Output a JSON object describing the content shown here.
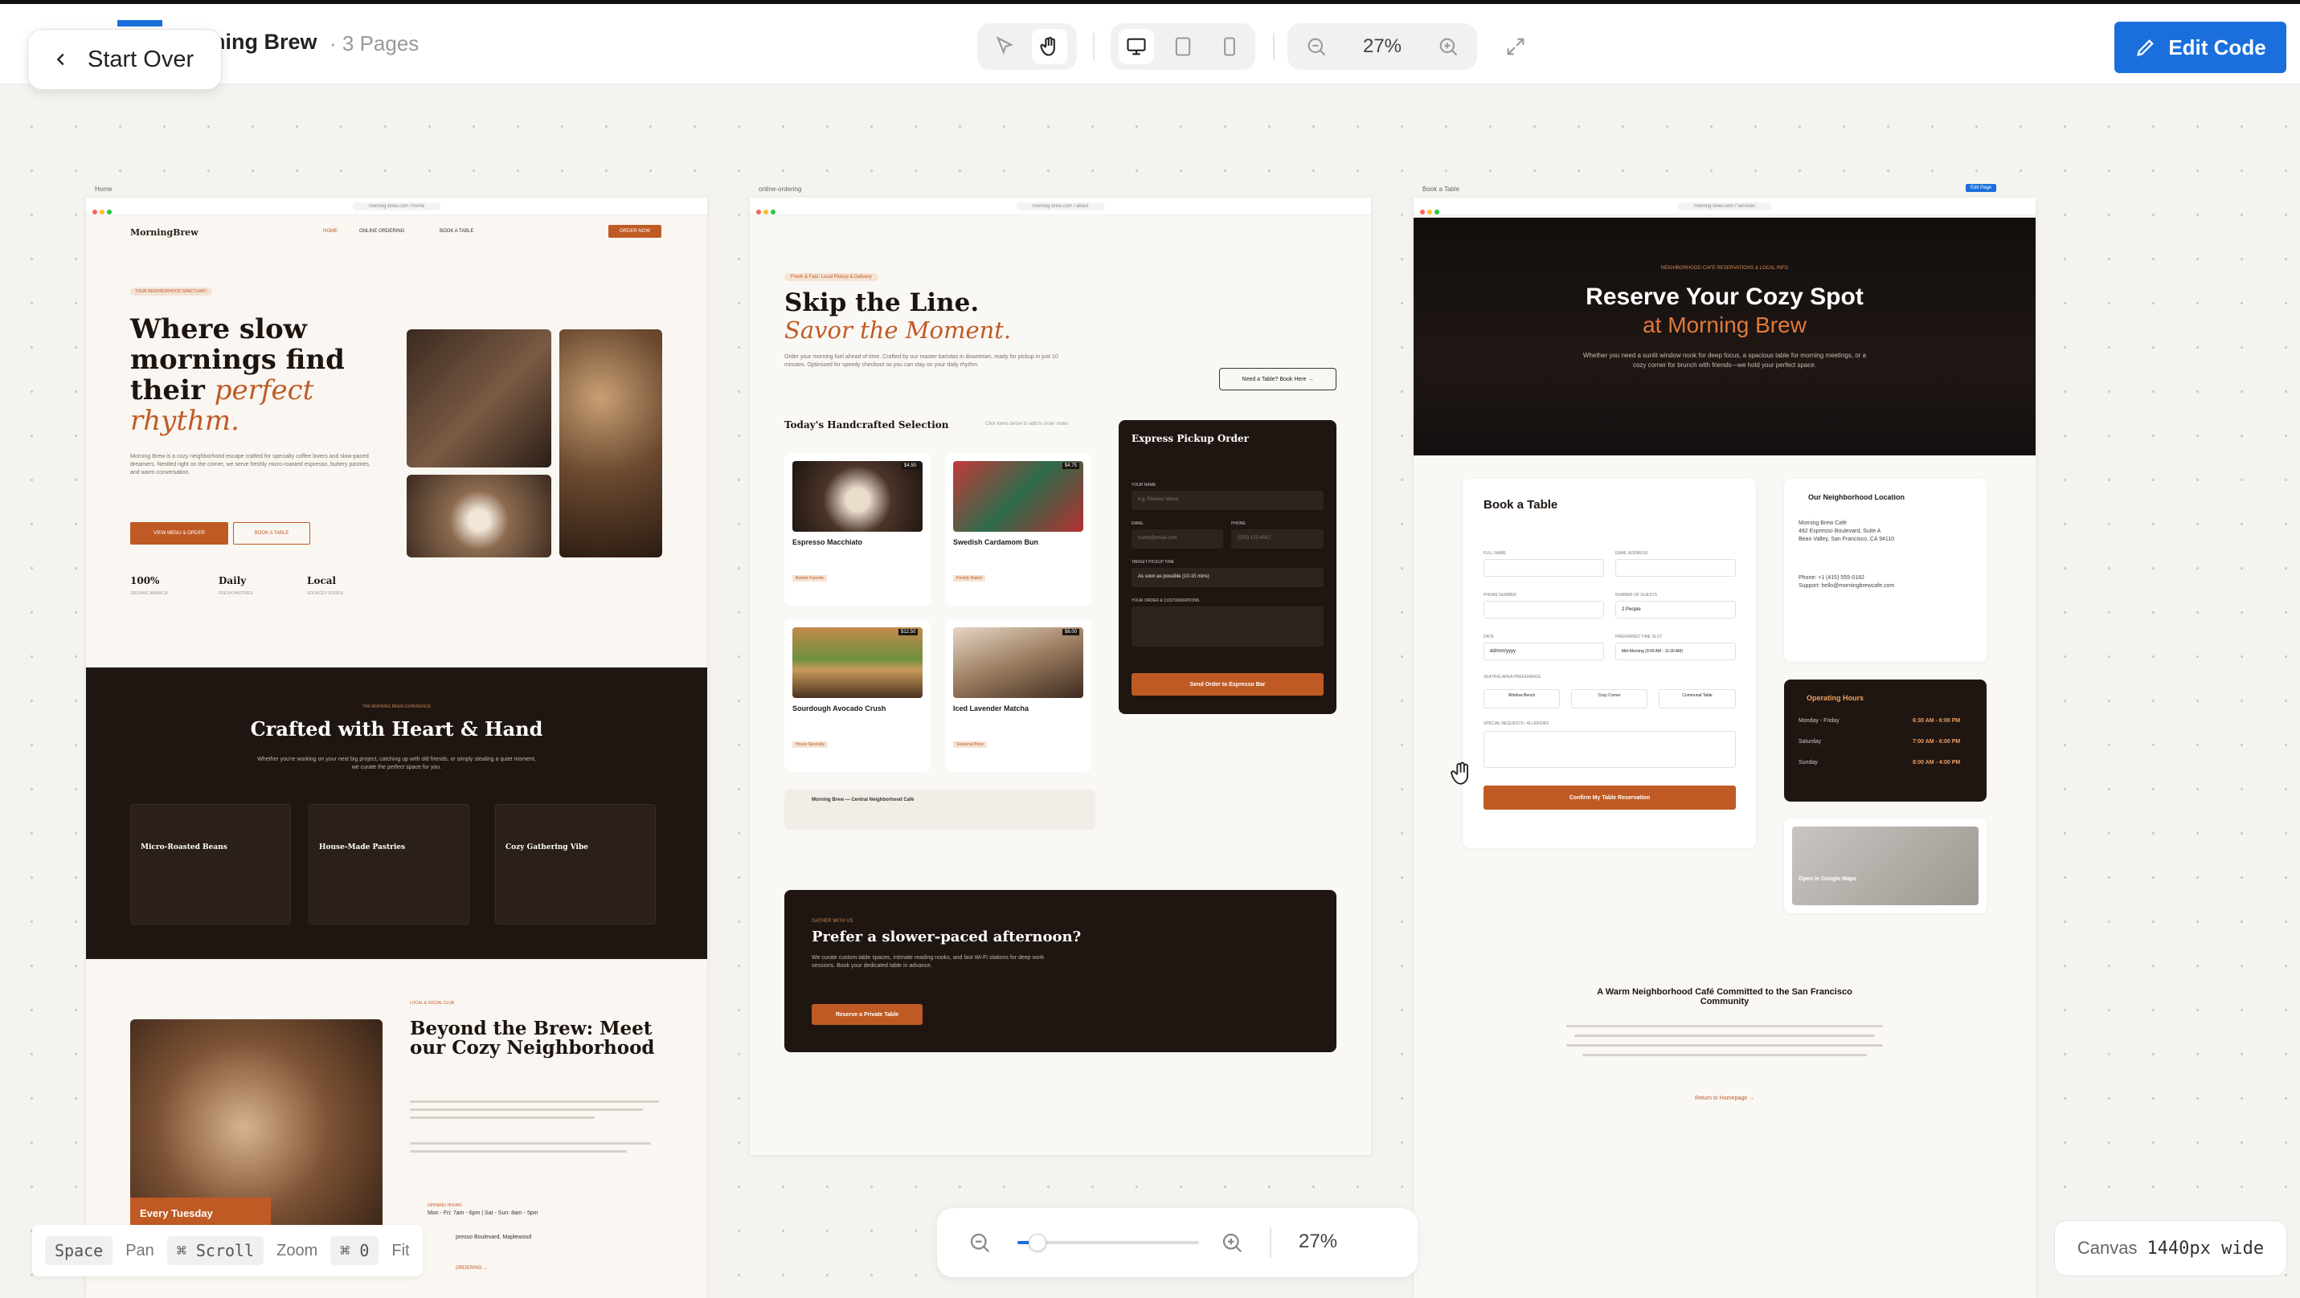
{
  "topbar": {
    "back_label": "Start Over",
    "project_name": "ning Brew",
    "pages_count": "· 3 Pages",
    "zoom_level": "27%",
    "edit_label": "Edit Code"
  },
  "frames": {
    "home": {
      "tag": "Home",
      "url": "morning-brew.com / home",
      "logo": "MorningBrew",
      "nav": [
        "HOME",
        "ONLINE ORDERING",
        "BOOK A TABLE"
      ],
      "nav_cta": "ORDER NOW",
      "eyebrow": "YOUR NEIGHBORHOOD SANCTUARY",
      "hero_title": "Where slow mornings find their",
      "hero_title_em": "perfect rhythm.",
      "hero_body": "Morning Brew is a cozy neighborhood escape crafted for specialty coffee lovers and slow-paced dreamers. Nestled right on the corner, we serve freshly micro-roasted espresso, buttery pastries, and warm conversation.",
      "btn_primary": "VIEW MENU & ORDER",
      "btn_secondary": "BOOK A TABLE",
      "stats": [
        {
          "value": "100%",
          "label": "ORGANIC ARABICA"
        },
        {
          "value": "Daily",
          "label": "FRESH PASTRIES"
        },
        {
          "value": "Local",
          "label": "SOURCED GOODS"
        }
      ],
      "dark_eyebrow": "THE MORNING BREW EXPERIENCE",
      "dark_title": "Crafted with Heart & Hand",
      "dark_body": "Whether you're working on your next big project, catching up with old friends, or simply stealing a quiet moment, we curate the perfect space for you.",
      "features": [
        "Micro-Roasted Beans",
        "House-Made Pastries",
        "Cozy Gathering Vibe"
      ],
      "section_eyebrow": "LOCAL & SOCIAL CLUB",
      "section_title": "Beyond the Brew: Meet our Cozy Neighborhood",
      "every_tuesday": "Every Tuesday",
      "hours_label": "OPENING HOURS",
      "hours": "Mon - Fri: 7am - 6pm | Sat - Sun: 8am - 5pm",
      "address": "presso Boulevard, Maplewood",
      "ordering": "ORDERING →"
    },
    "order": {
      "tag": "online-ordering",
      "url": "morning-brew.com / about",
      "badge": "Fresh & Fast: Local Pickup & Delivery",
      "title": "Skip the Line.",
      "title_em": "Savor the Moment.",
      "body": "Order your morning fuel ahead of time. Crafted by our master baristas in downtown, ready for pickup in just 10 minutes. Optimized for speedy checkout so you can stay on your daily rhythm.",
      "book_btn": "Need a Table? Book Here →",
      "selection_title": "Today's Handcrafted Selection",
      "selection_hint": "Click items below to add to order notes",
      "items": [
        {
          "name": "Espresso Macchiato",
          "price": "$4.50",
          "tag": "Barista Favorite"
        },
        {
          "name": "Swedish Cardamom Bun",
          "price": "$4.75",
          "tag": "Freshly Baked"
        },
        {
          "name": "Sourdough Avocado Crush",
          "price": "$12.50",
          "tag": "House Specialty"
        },
        {
          "name": "Iced Lavender Matcha",
          "price": "$6.00",
          "tag": "Seasonal Brew"
        }
      ],
      "form_title": "Express Pickup Order",
      "form_labels": [
        "YOUR NAME",
        "EMAIL",
        "PHONE",
        "TARGET PICKUP TIME",
        "YOUR ORDER & CUSTOMIZATIONS"
      ],
      "form_placeholders": [
        "e.g. Eleanor Vance",
        "name@email.com",
        "(555) 123-4567"
      ],
      "pickup_value": "As soon as possible (10-15 mins)",
      "send_btn": "Send Order to Espresso Bar",
      "location": "Morning Brew — Central Neighborhood Café",
      "promo_eyebrow": "GATHER WITH US",
      "promo_title": "Prefer a slower-paced afternoon?",
      "promo_body": "We curate custom table spaces, intimate reading nooks, and fast Wi-Fi stations for deep work sessions. Book your dedicated table in advance.",
      "promo_btn": "Reserve a Private Table"
    },
    "book": {
      "tag": "Book a Table",
      "url": "morning-brew.com / services",
      "edit_chip": "Edit Page",
      "eyebrow": "NEIGHBORHOOD CAFE RESERVATIONS & LOCAL INFO",
      "title": "Reserve Your Cozy Spot",
      "title_em": "at Morning Brew",
      "body": "Whether you need a sunlit window nook for deep focus, a spacious table for morning meetings, or a cozy corner for brunch with friends—we hold your perfect space.",
      "form_title": "Book a Table",
      "labels": [
        "FULL NAME",
        "EMAIL ADDRESS",
        "PHONE NUMBER",
        "NUMBER OF GUESTS",
        "DATE",
        "PREFERRED TIME SLOT",
        "SEATING AREA PREFERENCE",
        "SPECIAL REQUESTS / ALLERGIES"
      ],
      "guests": "2 People",
      "date": "dd/mm/yyyy",
      "time_slot": "Mid-Morning (9:00 AM - 11:30 AM)",
      "seating": [
        "Window Bench",
        "Cozy Corner",
        "Communal Table"
      ],
      "confirm_btn": "Confirm My Table Reservation",
      "loc_title": "Our Neighborhood Location",
      "address_lines": [
        "Morning Brew Café",
        "482 Espresso Boulevard, Suite A",
        "Bean Valley, San Francisco, CA 94110"
      ],
      "phone": "Phone: +1 (415) 555-0182",
      "support": "Support: hello@morningbrewcafe.com",
      "hours_title": "Operating Hours",
      "hours": [
        {
          "day": "Monday - Friday",
          "time": "6:30 AM - 6:00 PM"
        },
        {
          "day": "Saturday",
          "time": "7:00 AM - 6:00 PM"
        },
        {
          "day": "Sunday",
          "time": "8:00 AM - 4:00 PM"
        }
      ],
      "map_btn": "Open in Google Maps",
      "about_title": "A Warm Neighborhood Café Committed to the San Francisco Community",
      "return_link": "Return to Homepage →"
    }
  },
  "hints": {
    "space": "Space",
    "pan": "Pan",
    "scroll": "⌘ Scroll",
    "zoom": "Zoom",
    "fit_key": "⌘ 0",
    "fit": "Fit"
  },
  "zoombar": {
    "value": "27%",
    "slider_fraction": 0.08
  },
  "canvas": {
    "label": "Canvas",
    "width": "1440px wide"
  },
  "colors": {
    "accent": "#1a6fdd",
    "brand_orange": "#c05a24",
    "dark_brown": "#1f1612"
  }
}
